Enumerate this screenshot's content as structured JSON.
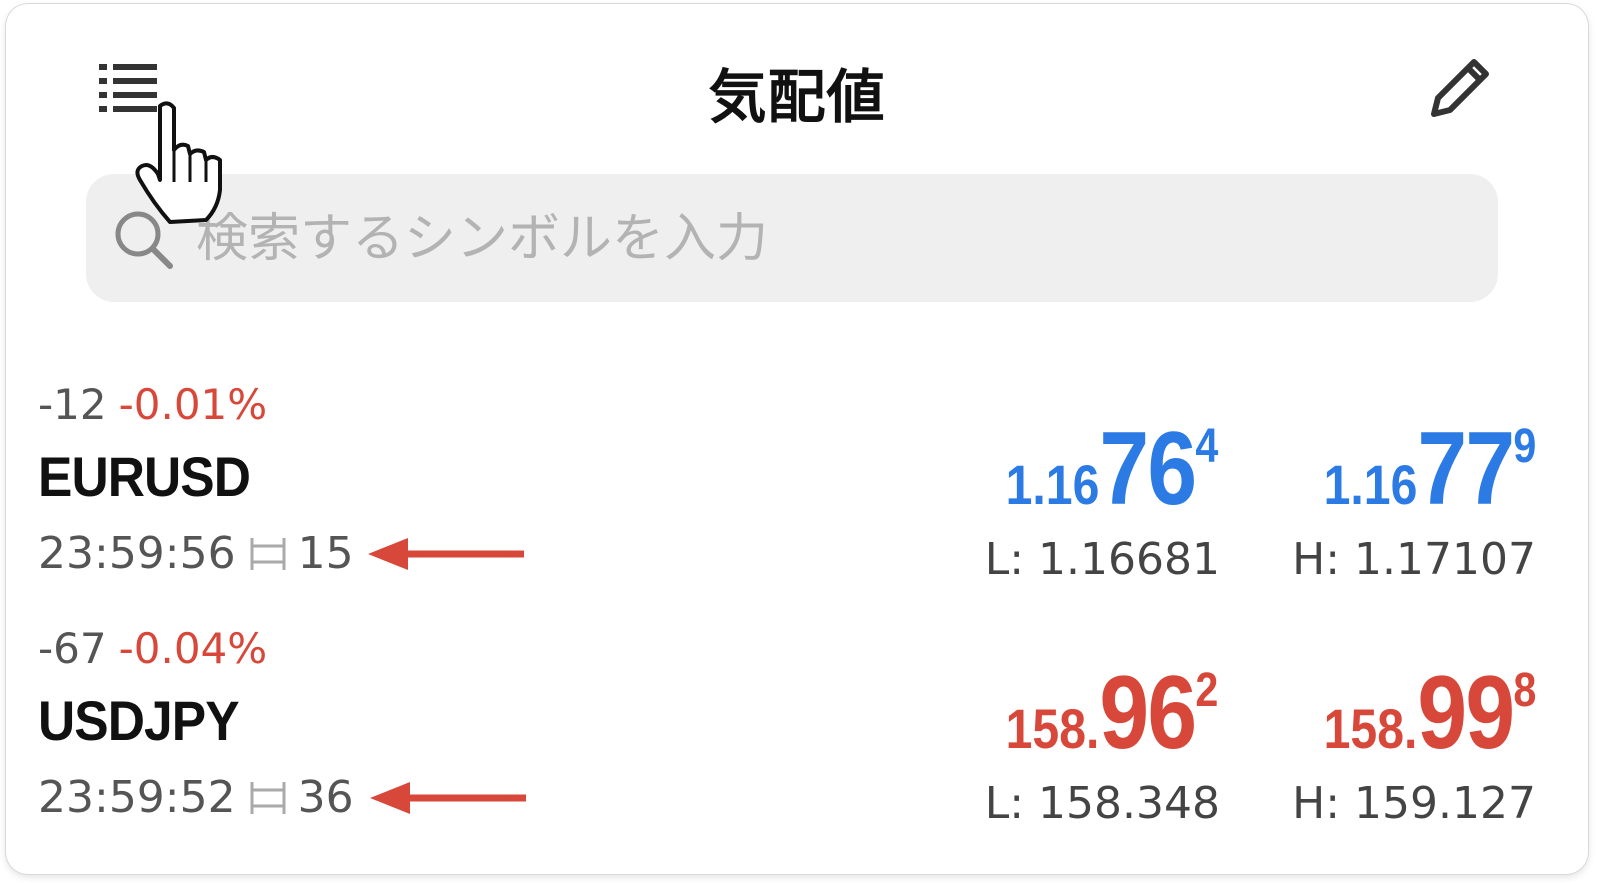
{
  "header": {
    "title": "気配値"
  },
  "search": {
    "placeholder": "検索するシンボルを入力"
  },
  "colors": {
    "up": "#2c7be5",
    "down": "#d8483a",
    "annotation_arrow": "#d8483a"
  },
  "icons": {
    "menu": "list-icon",
    "edit": "pencil-icon",
    "search": "search-icon",
    "cursor": "pointer-hand-icon",
    "spread": "spread-icon"
  },
  "quotes": [
    {
      "change": "-12",
      "change_pct": "-0.01%",
      "symbol": "EURUSD",
      "time": "23:59:56",
      "spread": "15",
      "bid": {
        "prefix": "1.16",
        "big": "76",
        "sup": "4"
      },
      "ask": {
        "prefix": "1.16",
        "big": "77",
        "sup": "9"
      },
      "low": "L: 1.16681",
      "high": "H: 1.17107",
      "price_color": "blue"
    },
    {
      "change": "-67",
      "change_pct": "-0.04%",
      "symbol": "USDJPY",
      "time": "23:59:52",
      "spread": "36",
      "bid": {
        "prefix": "158.",
        "big": "96",
        "sup": "2"
      },
      "ask": {
        "prefix": "158.",
        "big": "99",
        "sup": "8"
      },
      "low": "L: 158.348",
      "high": "H: 159.127",
      "price_color": "red"
    }
  ]
}
